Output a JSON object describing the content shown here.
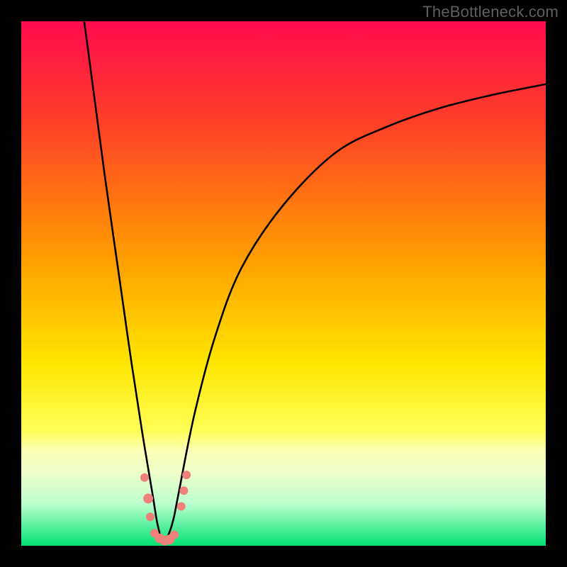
{
  "watermark": "TheBottleneck.com",
  "chart_data": {
    "type": "line",
    "title": "",
    "xlabel": "",
    "ylabel": "",
    "xlim": [
      0,
      100
    ],
    "ylim": [
      0,
      100
    ],
    "grid": false,
    "legend": false,
    "background": {
      "type": "vertical_gradient",
      "stops": [
        {
          "t": 0.0,
          "color": "#ff0b4f"
        },
        {
          "t": 0.2,
          "color": "#ff4227"
        },
        {
          "t": 0.45,
          "color": "#ff9d00"
        },
        {
          "t": 0.65,
          "color": "#ffe500"
        },
        {
          "t": 0.78,
          "color": "#ffff56"
        },
        {
          "t": 0.82,
          "color": "#fbffb8"
        },
        {
          "t": 0.86,
          "color": "#efffc8"
        },
        {
          "t": 0.92,
          "color": "#bcffd0"
        },
        {
          "t": 1.0,
          "color": "#00e372"
        }
      ]
    },
    "curve": {
      "description": "V-shaped bottleneck curve; y is bottleneck % (0 = none, 100 = worst) vs a ratio x; minimum near x≈27",
      "x": [
        12,
        14,
        16,
        19,
        21,
        23,
        25,
        26,
        27,
        28,
        29,
        30,
        33,
        37,
        42,
        50,
        60,
        70,
        80,
        90,
        100
      ],
      "y": [
        100,
        85,
        70,
        49,
        35,
        22,
        10,
        4,
        1,
        2,
        5,
        10,
        25,
        40,
        53,
        65,
        75,
        80,
        83.5,
        86,
        88
      ]
    },
    "markers": {
      "description": "Salmon-colored sample dots clustered near the curve minimum",
      "color": "#ee8179",
      "points": [
        {
          "x": 23.5,
          "y": 13,
          "r": 6
        },
        {
          "x": 24.2,
          "y": 9,
          "r": 7
        },
        {
          "x": 24.6,
          "y": 5.5,
          "r": 6
        },
        {
          "x": 25.4,
          "y": 2.4,
          "r": 6
        },
        {
          "x": 26.4,
          "y": 1.4,
          "r": 7
        },
        {
          "x": 27.4,
          "y": 1.0,
          "r": 7
        },
        {
          "x": 28.3,
          "y": 1.2,
          "r": 7
        },
        {
          "x": 29.2,
          "y": 2.1,
          "r": 6
        },
        {
          "x": 30.5,
          "y": 7.5,
          "r": 6
        },
        {
          "x": 31.0,
          "y": 10.5,
          "r": 6
        },
        {
          "x": 31.5,
          "y": 13.5,
          "r": 6
        }
      ]
    }
  }
}
